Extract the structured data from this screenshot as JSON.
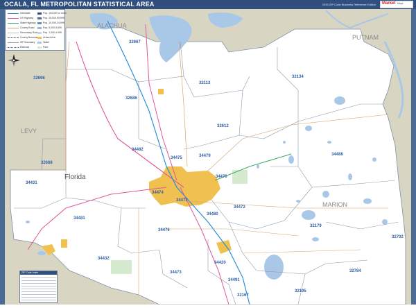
{
  "header": {
    "title": "OCALA, FL METROPOLITAN STATISTICAL AREA",
    "edition": "2020 ZIP Code Business Reference Edition",
    "logo_main": "Market",
    "logo_sub": "Maps"
  },
  "colors": {
    "frame": "#4a6b93",
    "title_bar": "#2f4f7f",
    "land_in_area": "#ffffff",
    "land_outside": "#d9d5c3",
    "water": "#a9c8e8",
    "urban": "#f0c050",
    "park": "#d6ead0",
    "zip_label": "#2f5fa5",
    "boundary": "#7f8fa8",
    "highway_pink": "#e0559a",
    "highway_blue": "#2a8fd8",
    "highway_green": "#3aa867",
    "road_orange": "#d7a26b"
  },
  "map": {
    "place_label": "Florida",
    "county_labels": [
      "ALACHUA",
      "PUTNAM",
      "LEVY",
      "MARION"
    ],
    "zip_labels": [
      "32667",
      "32113",
      "32134",
      "32696",
      "32686",
      "32612",
      "34482",
      "34475",
      "34479",
      "32668",
      "34470",
      "34488",
      "34431",
      "34474",
      "34471",
      "34481",
      "34472",
      "32179",
      "34476",
      "34480",
      "32702",
      "34432",
      "34473",
      "34420",
      "34491",
      "32784",
      "32195",
      "32167"
    ]
  },
  "legend": {
    "rows": [
      {
        "label": "Interstate"
      },
      {
        "label": "US Highway"
      },
      {
        "label": "State Highway"
      },
      {
        "label": "County Road"
      },
      {
        "label": "Secondary Road"
      },
      {
        "label": "County Boundary"
      },
      {
        "label": "ZIP Boundary"
      },
      {
        "label": "Railroad"
      }
    ],
    "right_rows": [
      {
        "label": "Pop. 100,000 or more"
      },
      {
        "label": "Pop. 25,000-99,999"
      },
      {
        "label": "Pop. 10,000-24,999"
      },
      {
        "label": "Pop. 5,000-9,999"
      },
      {
        "label": "Pop. 1,000-4,999"
      },
      {
        "label": "Urban Area"
      },
      {
        "label": "Water"
      },
      {
        "label": "Park"
      }
    ]
  },
  "index": {
    "title": "ZIP Code Index"
  }
}
